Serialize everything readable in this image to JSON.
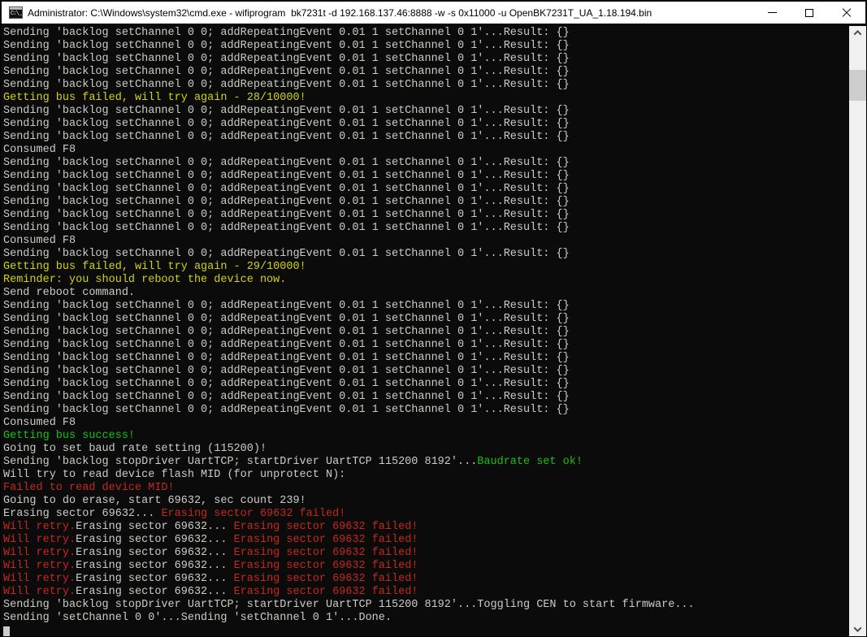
{
  "window": {
    "title": "Administrator: C:\\Windows\\system32\\cmd.exe - wifiprogram  bk7231t -d 192.168.137.46:8888 -w -s 0x11000 -u OpenBK7231T_UA_1.18.194.bin",
    "icons": {
      "app_icon": "cmd-icon",
      "minimize": "minimize-icon",
      "maximize": "maximize-icon",
      "close": "close-icon",
      "scroll_up": "chevron-up-icon",
      "scroll_down": "chevron-down-icon"
    }
  },
  "terminal": {
    "background": "#0b0b0b",
    "colors": {
      "d": "#c9cdc6",
      "y": "#d2d211",
      "G": "#17c212",
      "r": "#c5281c"
    },
    "cursor": "█",
    "lines": [
      [
        [
          "Sending 'backlog setChannel 0 0; addRepeatingEvent 0.01 1 setChannel 0 1'...Result: {}",
          "d"
        ]
      ],
      [
        [
          "Sending 'backlog setChannel 0 0; addRepeatingEvent 0.01 1 setChannel 0 1'...Result: {}",
          "d"
        ]
      ],
      [
        [
          "Sending 'backlog setChannel 0 0; addRepeatingEvent 0.01 1 setChannel 0 1'...Result: {}",
          "d"
        ]
      ],
      [
        [
          "Sending 'backlog setChannel 0 0; addRepeatingEvent 0.01 1 setChannel 0 1'...Result: {}",
          "d"
        ]
      ],
      [
        [
          "Sending 'backlog setChannel 0 0; addRepeatingEvent 0.01 1 setChannel 0 1'...Result: {}",
          "d"
        ]
      ],
      [
        [
          "Getting bus failed, will try again - 28/10000!",
          "y"
        ]
      ],
      [
        [
          "Sending 'backlog setChannel 0 0; addRepeatingEvent 0.01 1 setChannel 0 1'...Result: {}",
          "d"
        ]
      ],
      [
        [
          "Sending 'backlog setChannel 0 0; addRepeatingEvent 0.01 1 setChannel 0 1'...Result: {}",
          "d"
        ]
      ],
      [
        [
          "Sending 'backlog setChannel 0 0; addRepeatingEvent 0.01 1 setChannel 0 1'...Result: {}",
          "d"
        ]
      ],
      [
        [
          "Consumed F8",
          "d"
        ]
      ],
      [
        [
          "Sending 'backlog setChannel 0 0; addRepeatingEvent 0.01 1 setChannel 0 1'...Result: {}",
          "d"
        ]
      ],
      [
        [
          "Sending 'backlog setChannel 0 0; addRepeatingEvent 0.01 1 setChannel 0 1'...Result: {}",
          "d"
        ]
      ],
      [
        [
          "Sending 'backlog setChannel 0 0; addRepeatingEvent 0.01 1 setChannel 0 1'...Result: {}",
          "d"
        ]
      ],
      [
        [
          "Sending 'backlog setChannel 0 0; addRepeatingEvent 0.01 1 setChannel 0 1'...Result: {}",
          "d"
        ]
      ],
      [
        [
          "Sending 'backlog setChannel 0 0; addRepeatingEvent 0.01 1 setChannel 0 1'...Result: {}",
          "d"
        ]
      ],
      [
        [
          "Sending 'backlog setChannel 0 0; addRepeatingEvent 0.01 1 setChannel 0 1'...Result: {}",
          "d"
        ]
      ],
      [
        [
          "Consumed F8",
          "d"
        ]
      ],
      [
        [
          "Sending 'backlog setChannel 0 0; addRepeatingEvent 0.01 1 setChannel 0 1'...Result: {}",
          "d"
        ]
      ],
      [
        [
          "Getting bus failed, will try again - 29/10000!",
          "y"
        ]
      ],
      [
        [
          "Reminder: you should reboot the device now.",
          "y"
        ]
      ],
      [
        [
          "Send reboot command.",
          "d"
        ]
      ],
      [
        [
          "Sending 'backlog setChannel 0 0; addRepeatingEvent 0.01 1 setChannel 0 1'...Result: {}",
          "d"
        ]
      ],
      [
        [
          "Sending 'backlog setChannel 0 0; addRepeatingEvent 0.01 1 setChannel 0 1'...Result: {}",
          "d"
        ]
      ],
      [
        [
          "Sending 'backlog setChannel 0 0; addRepeatingEvent 0.01 1 setChannel 0 1'...Result: {}",
          "d"
        ]
      ],
      [
        [
          "Sending 'backlog setChannel 0 0; addRepeatingEvent 0.01 1 setChannel 0 1'...Result: {}",
          "d"
        ]
      ],
      [
        [
          "Sending 'backlog setChannel 0 0; addRepeatingEvent 0.01 1 setChannel 0 1'...Result: {}",
          "d"
        ]
      ],
      [
        [
          "Sending 'backlog setChannel 0 0; addRepeatingEvent 0.01 1 setChannel 0 1'...Result: {}",
          "d"
        ]
      ],
      [
        [
          "Sending 'backlog setChannel 0 0; addRepeatingEvent 0.01 1 setChannel 0 1'...Result: {}",
          "d"
        ]
      ],
      [
        [
          "Sending 'backlog setChannel 0 0; addRepeatingEvent 0.01 1 setChannel 0 1'...Result: {}",
          "d"
        ]
      ],
      [
        [
          "Sending 'backlog setChannel 0 0; addRepeatingEvent 0.01 1 setChannel 0 1'...Result: {}",
          "d"
        ]
      ],
      [
        [
          "Consumed F8",
          "d"
        ]
      ],
      [
        [
          "Getting bus success!",
          "G"
        ]
      ],
      [
        [
          "Going to set baud rate setting (115200)!",
          "d"
        ]
      ],
      [
        [
          "Sending 'backlog stopDriver UartTCP; startDriver UartTCP 115200 8192'...",
          "d"
        ],
        [
          "Baudrate set ok!",
          "G"
        ]
      ],
      [
        [
          "Will try to read device flash MID (for unprotect N):",
          "d"
        ]
      ],
      [
        [
          "Failed to read device MID!",
          "r"
        ]
      ],
      [
        [
          "Going to do erase, start 69632, sec count 239!",
          "d"
        ]
      ],
      [
        [
          "Erasing sector 69632... ",
          "d"
        ],
        [
          "Erasing sector 69632 failed!",
          "r"
        ]
      ],
      [
        [
          "Will retry.",
          "r"
        ],
        [
          "Erasing sector 69632... ",
          "d"
        ],
        [
          "Erasing sector 69632 failed!",
          "r"
        ]
      ],
      [
        [
          "Will retry.",
          "r"
        ],
        [
          "Erasing sector 69632... ",
          "d"
        ],
        [
          "Erasing sector 69632 failed!",
          "r"
        ]
      ],
      [
        [
          "Will retry.",
          "r"
        ],
        [
          "Erasing sector 69632... ",
          "d"
        ],
        [
          "Erasing sector 69632 failed!",
          "r"
        ]
      ],
      [
        [
          "Will retry.",
          "r"
        ],
        [
          "Erasing sector 69632... ",
          "d"
        ],
        [
          "Erasing sector 69632 failed!",
          "r"
        ]
      ],
      [
        [
          "Will retry.",
          "r"
        ],
        [
          "Erasing sector 69632... ",
          "d"
        ],
        [
          "Erasing sector 69632 failed!",
          "r"
        ]
      ],
      [
        [
          "Will retry.",
          "r"
        ],
        [
          "Erasing sector 69632... ",
          "d"
        ],
        [
          "Erasing sector 69632 failed!",
          "r"
        ]
      ],
      [
        [
          "Sending 'backlog stopDriver UartTCP; startDriver UartTCP 115200 8192'...Toggling CEN to start firmware...",
          "d"
        ]
      ],
      [
        [
          "Sending 'setChannel 0 0'...Sending 'setChannel 0 1'...Done.",
          "d"
        ]
      ]
    ]
  },
  "scrollbar": {
    "track_color": "#f0f0f0",
    "thumb_color": "#cdcdcd"
  }
}
